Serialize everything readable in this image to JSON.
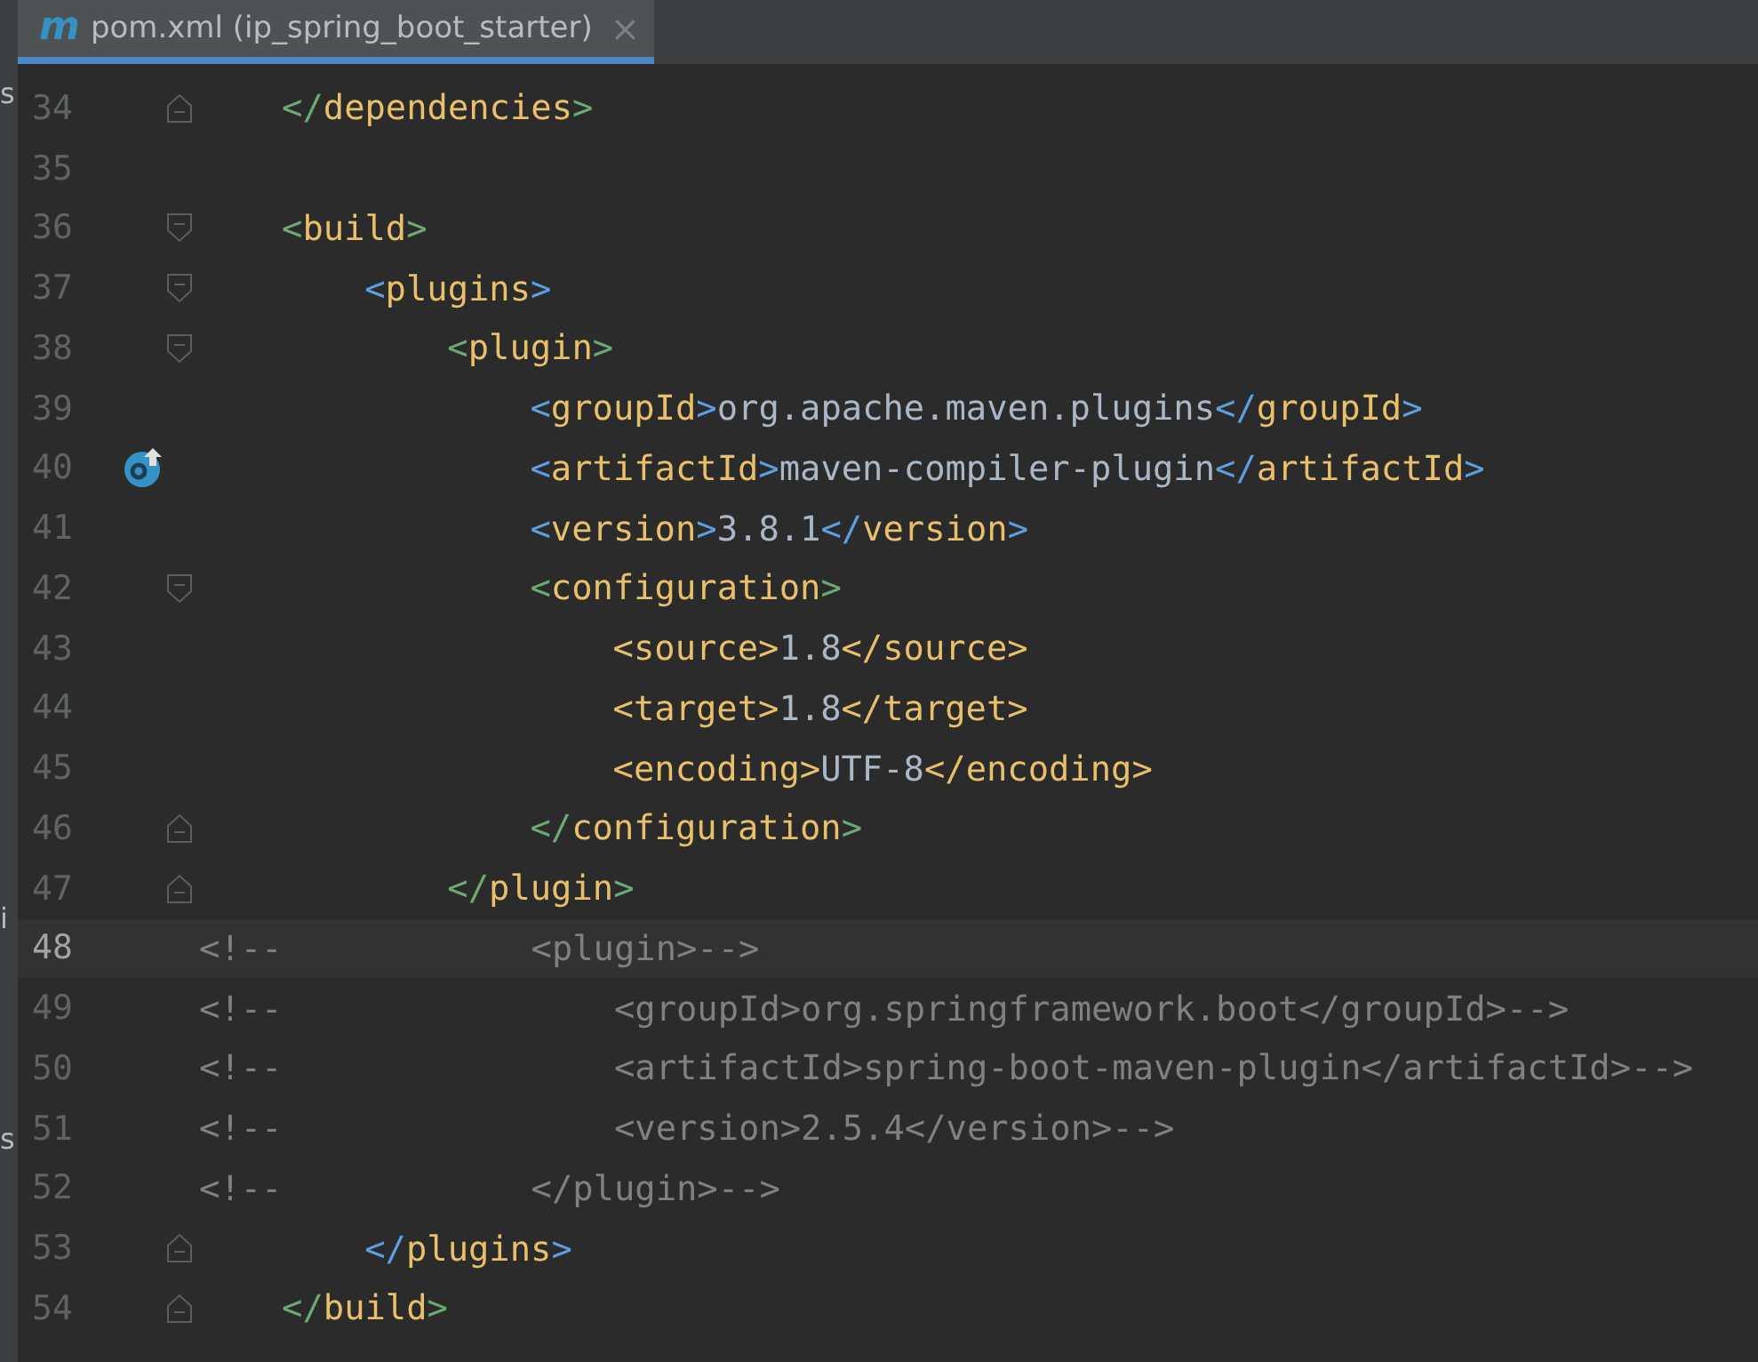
{
  "side_panel": {
    "fragments": [
      {
        "text": "s"
      },
      {
        "text": "i"
      },
      {
        "text": "s"
      }
    ]
  },
  "tab": {
    "icon_letter": "m",
    "title": "pom.xml (ip_spring_boot_starter)",
    "close": "×",
    "selected": true
  },
  "lines": [
    {
      "number": "34",
      "current": false,
      "fold_start": false,
      "fold_end": true,
      "gutter_icon": false,
      "tokens": [
        {
          "kind": "bracket",
          "text": "</",
          "color": "#6aab73"
        },
        {
          "kind": "tag",
          "text": "dependencies"
        },
        {
          "kind": "bracket",
          "text": ">",
          "color": "#6aab73"
        }
      ]
    },
    {
      "number": "35",
      "current": false,
      "fold_start": false,
      "fold_end": false,
      "gutter_icon": false
    },
    {
      "number": "36",
      "current": false,
      "fold_start": true,
      "fold_end": false,
      "gutter_icon": false,
      "tokens": [
        {
          "kind": "bracket",
          "text": "<",
          "color": "#6aab73"
        },
        {
          "kind": "tag",
          "text": "build"
        },
        {
          "kind": "bracket",
          "text": ">",
          "color": "#6aab73"
        }
      ],
      "children": [
        {
          "number": "37",
          "current": false,
          "fold_start": true,
          "fold_end": false,
          "gutter_icon": false,
          "tokens": [
            {
              "kind": "bracket",
              "text": "<",
              "color": "#5c9fdf"
            },
            {
              "kind": "tag",
              "text": "plugins"
            },
            {
              "kind": "bracket",
              "text": ">",
              "color": "#5c9fdf"
            }
          ],
          "children": [
            {
              "number": "38",
              "current": false,
              "fold_start": true,
              "fold_end": false,
              "gutter_icon": false,
              "tokens": [
                {
                  "kind": "bracket",
                  "text": "<",
                  "color": "#6aab73"
                },
                {
                  "kind": "tag",
                  "text": "plugin"
                },
                {
                  "kind": "bracket",
                  "text": ">",
                  "color": "#6aab73"
                }
              ],
              "children": [
                {
                  "number": "39",
                  "current": false,
                  "fold_start": false,
                  "fold_end": false,
                  "gutter_icon": false,
                  "tokens": [
                    {
                      "kind": "bracket",
                      "text": "<",
                      "color": "#5c9fdf"
                    },
                    {
                      "kind": "tag",
                      "text": "groupId"
                    },
                    {
                      "kind": "bracket",
                      "text": ">",
                      "color": "#5c9fdf"
                    },
                    {
                      "kind": "value",
                      "text": "org.apache.maven.plugins"
                    },
                    {
                      "kind": "bracket",
                      "text": "</",
                      "color": "#5c9fdf"
                    },
                    {
                      "kind": "tag",
                      "text": "groupId"
                    },
                    {
                      "kind": "bracket",
                      "text": ">",
                      "color": "#5c9fdf"
                    }
                  ]
                },
                {
                  "number": "40",
                  "current": false,
                  "fold_start": false,
                  "fold_end": false,
                  "gutter_icon": true,
                  "tokens": [
                    {
                      "kind": "bracket",
                      "text": "<",
                      "color": "#5c9fdf"
                    },
                    {
                      "kind": "tag",
                      "text": "artifactId"
                    },
                    {
                      "kind": "bracket",
                      "text": ">",
                      "color": "#5c9fdf"
                    },
                    {
                      "kind": "value",
                      "text": "maven-compiler-plugin"
                    },
                    {
                      "kind": "bracket",
                      "text": "</",
                      "color": "#5c9fdf"
                    },
                    {
                      "kind": "tag",
                      "text": "artifactId"
                    },
                    {
                      "kind": "bracket",
                      "text": ">",
                      "color": "#5c9fdf"
                    }
                  ]
                },
                {
                  "number": "41",
                  "current": false,
                  "fold_start": false,
                  "fold_end": false,
                  "gutter_icon": false,
                  "tokens": [
                    {
                      "kind": "bracket",
                      "text": "<",
                      "color": "#5c9fdf"
                    },
                    {
                      "kind": "tag",
                      "text": "version"
                    },
                    {
                      "kind": "bracket",
                      "text": ">",
                      "color": "#5c9fdf"
                    },
                    {
                      "kind": "value",
                      "text": "3.8.1"
                    },
                    {
                      "kind": "bracket",
                      "text": "</",
                      "color": "#5c9fdf"
                    },
                    {
                      "kind": "tag",
                      "text": "version"
                    },
                    {
                      "kind": "bracket",
                      "text": ">",
                      "color": "#5c9fdf"
                    }
                  ]
                },
                {
                  "number": "42",
                  "current": false,
                  "fold_start": true,
                  "fold_end": false,
                  "gutter_icon": false,
                  "tokens": [
                    {
                      "kind": "bracket",
                      "text": "<",
                      "color": "#6aab73"
                    },
                    {
                      "kind": "tag",
                      "text": "configuration"
                    },
                    {
                      "kind": "bracket",
                      "text": ">",
                      "color": "#6aab73"
                    }
                  ],
                  "children": [
                    {
                      "number": "43",
                      "current": false,
                      "fold_start": false,
                      "fold_end": false,
                      "gutter_icon": false,
                      "tokens": [
                        {
                          "kind": "bracket",
                          "text": "<",
                          "color": "#e8bf6a"
                        },
                        {
                          "kind": "tag",
                          "text": "source"
                        },
                        {
                          "kind": "bracket",
                          "text": ">",
                          "color": "#e8bf6a"
                        },
                        {
                          "kind": "value",
                          "text": "1.8"
                        },
                        {
                          "kind": "bracket",
                          "text": "</",
                          "color": "#e8bf6a"
                        },
                        {
                          "kind": "tag",
                          "text": "source"
                        },
                        {
                          "kind": "bracket",
                          "text": ">",
                          "color": "#e8bf6a"
                        }
                      ]
                    },
                    {
                      "number": "44",
                      "current": false,
                      "fold_start": false,
                      "fold_end": false,
                      "gutter_icon": false,
                      "tokens": [
                        {
                          "kind": "bracket",
                          "text": "<",
                          "color": "#e8bf6a"
                        },
                        {
                          "kind": "tag",
                          "text": "target"
                        },
                        {
                          "kind": "bracket",
                          "text": ">",
                          "color": "#e8bf6a"
                        },
                        {
                          "kind": "value",
                          "text": "1.8"
                        },
                        {
                          "kind": "bracket",
                          "text": "</",
                          "color": "#e8bf6a"
                        },
                        {
                          "kind": "tag",
                          "text": "target"
                        },
                        {
                          "kind": "bracket",
                          "text": ">",
                          "color": "#e8bf6a"
                        }
                      ]
                    },
                    {
                      "number": "45",
                      "current": false,
                      "fold_start": false,
                      "fold_end": false,
                      "gutter_icon": false,
                      "tokens": [
                        {
                          "kind": "bracket",
                          "text": "<",
                          "color": "#e8bf6a"
                        },
                        {
                          "kind": "tag",
                          "text": "encoding"
                        },
                        {
                          "kind": "bracket",
                          "text": ">",
                          "color": "#e8bf6a"
                        },
                        {
                          "kind": "value",
                          "text": "UTF-8"
                        },
                        {
                          "kind": "bracket",
                          "text": "</",
                          "color": "#e8bf6a"
                        },
                        {
                          "kind": "tag",
                          "text": "encoding"
                        },
                        {
                          "kind": "bracket",
                          "text": ">",
                          "color": "#e8bf6a"
                        }
                      ]
                    }
                  ]
                },
                {
                  "number": "46",
                  "current": false,
                  "fold_start": false,
                  "fold_end": true,
                  "gutter_icon": false,
                  "tokens": [
                    {
                      "kind": "bracket",
                      "text": "</",
                      "color": "#6aab73"
                    },
                    {
                      "kind": "tag",
                      "text": "configuration"
                    },
                    {
                      "kind": "bracket",
                      "text": ">",
                      "color": "#6aab73"
                    }
                  ]
                }
              ]
            },
            {
              "number": "47",
              "current": false,
              "fold_start": false,
              "fold_end": true,
              "gutter_icon": false,
              "tokens": [
                {
                  "kind": "bracket",
                  "text": "</",
                  "color": "#6aab73"
                },
                {
                  "kind": "tag",
                  "text": "plugin"
                },
                {
                  "kind": "bracket",
                  "text": ">",
                  "color": "#6aab73"
                }
              ]
            },
            {
              "number": "48",
              "current": true,
              "fold_start": false,
              "fold_end": false,
              "gutter_icon": false,
              "tokens": [
                {
                  "kind": "comment",
                  "text": "<!--            <plugin>-->"
                }
              ]
            },
            {
              "number": "49",
              "current": false,
              "fold_start": false,
              "fold_end": false,
              "gutter_icon": false,
              "tokens": [
                {
                  "kind": "comment",
                  "text": "<!--                <groupId>org.springframework.boot</groupId>-->"
                }
              ]
            },
            {
              "number": "50",
              "current": false,
              "fold_start": false,
              "fold_end": false,
              "gutter_icon": false,
              "tokens": [
                {
                  "kind": "comment",
                  "text": "<!--                <artifactId>spring-boot-maven-plugin</artifactId>-->"
                }
              ]
            },
            {
              "number": "51",
              "current": false,
              "fold_start": false,
              "fold_end": false,
              "gutter_icon": false,
              "tokens": [
                {
                  "kind": "comment",
                  "text": "<!--                <version>2.5.4</version>-->"
                }
              ]
            },
            {
              "number": "52",
              "current": false,
              "fold_start": false,
              "fold_end": false,
              "gutter_icon": false,
              "tokens": [
                {
                  "kind": "comment",
                  "text": "<!--            </plugin>-->"
                }
              ]
            }
          ]
        },
        {
          "number": "53",
          "current": false,
          "fold_start": false,
          "fold_end": true,
          "gutter_icon": false,
          "tokens": [
            {
              "kind": "bracket",
              "text": "</",
              "color": "#5c9fdf"
            },
            {
              "kind": "tag",
              "text": "plugins"
            },
            {
              "kind": "bracket",
              "text": ">",
              "color": "#5c9fdf"
            }
          ]
        }
      ]
    },
    {
      "number": "54",
      "current": false,
      "fold_start": false,
      "fold_end": true,
      "gutter_icon": false,
      "tokens": [
        {
          "kind": "bracket",
          "text": "</",
          "color": "#6aab73"
        },
        {
          "kind": "tag",
          "text": "build"
        },
        {
          "kind": "bracket",
          "text": ">",
          "color": "#6aab73"
        }
      ]
    }
  ]
}
